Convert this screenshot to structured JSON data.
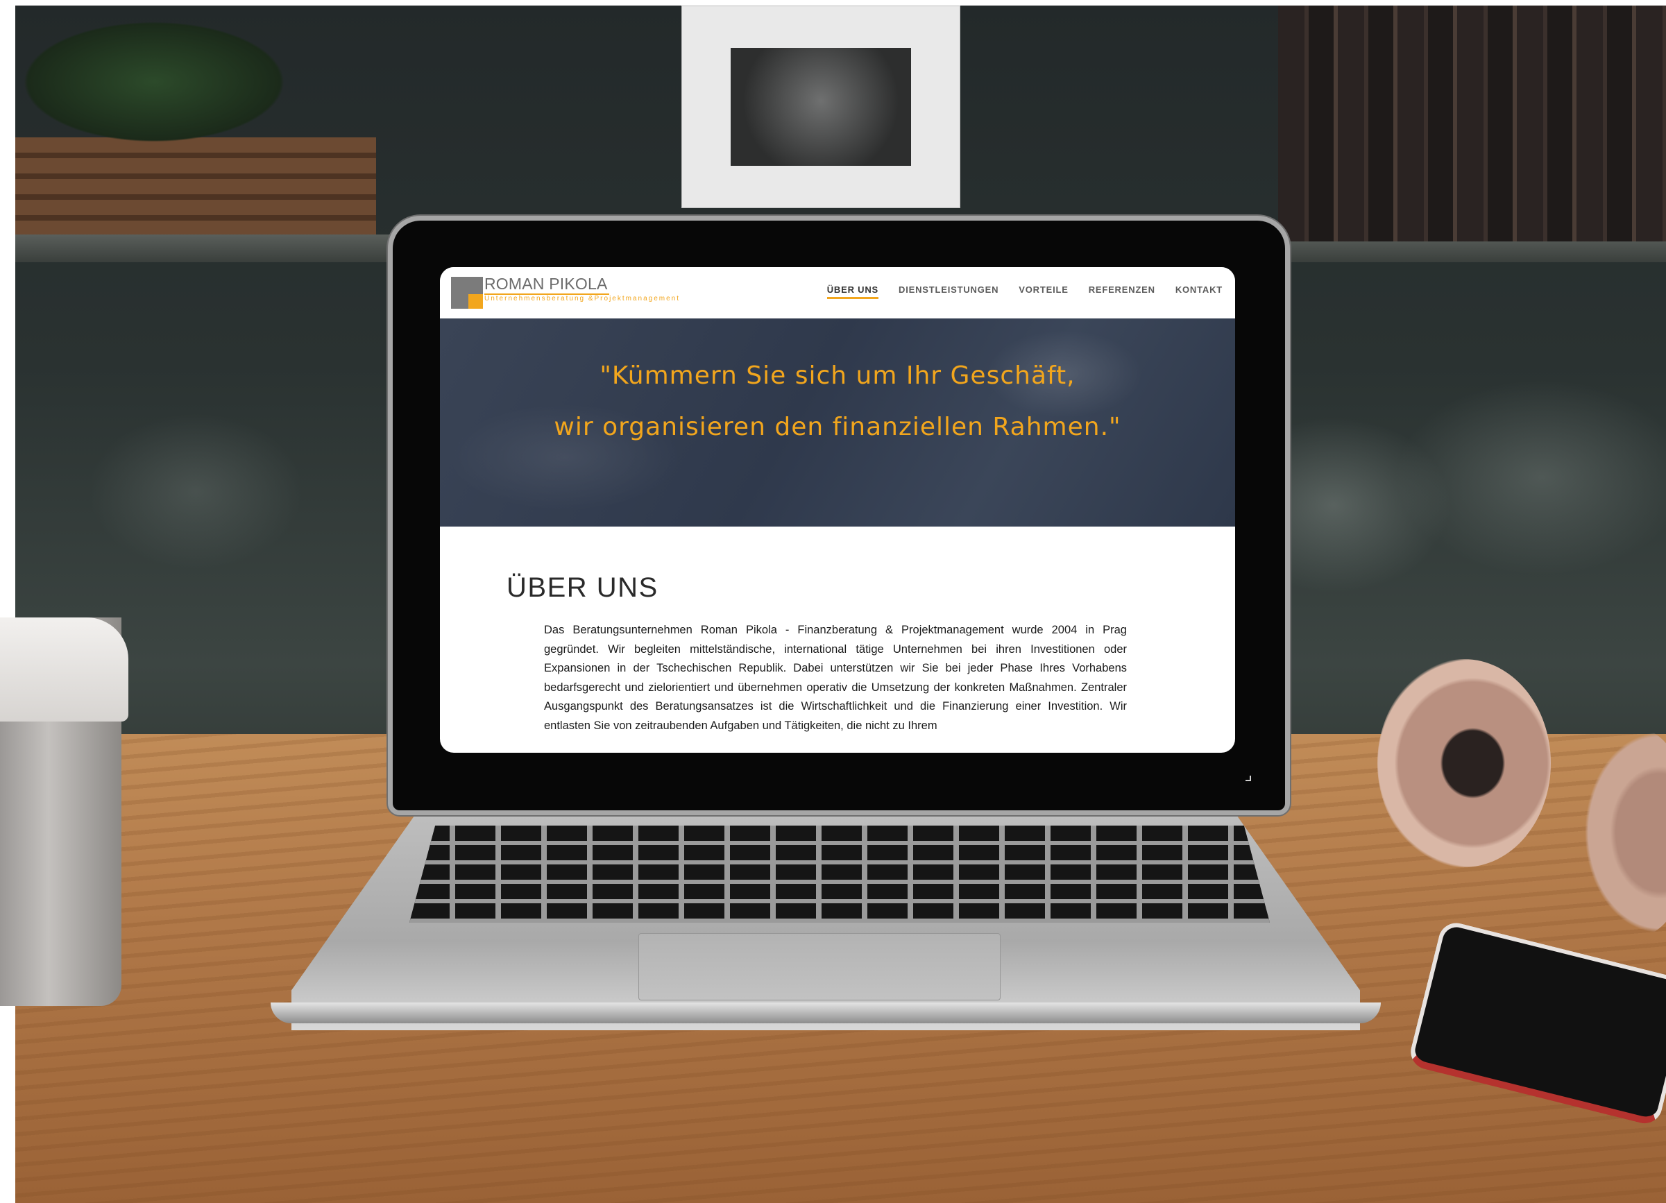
{
  "website": {
    "logo": {
      "name": "ROMAN PIKOLA",
      "subtitle": "Unternehmensberatung &Projektmanagement"
    },
    "nav": [
      "ÜBER UNS",
      "DIENSTLEISTUNGEN",
      "VORTEILE",
      "REFERENZEN",
      "KONTAKT"
    ],
    "nav_active": "ÜBER UNS",
    "hero": {
      "line1": "\"Kümmern Sie sich um Ihr Geschäft,",
      "line2": "wir organisieren den finanziellen Rahmen.\""
    },
    "section": {
      "title": "ÜBER UNS",
      "body": "Das Beratungsunternehmen Roman Pikola - Finanzberatung & Projektmanagement wurde 2004 in Prag gegründet. Wir begleiten mittelständische, international tätige Unternehmen bei ihren Investitionen oder Expansionen in der Tschechischen Republik. Dabei unterstützen wir Sie bei jeder Phase Ihres Vorhabens bedarfsgerecht und zielorientiert und übernehmen operativ die Umsetzung der konkreten Maßnahmen. Zentraler Ausgangspunkt des Beratungsansatzes ist die Wirtschaftlichkeit und die Finanzierung einer Investition. Wir entlasten Sie von zeitraubenden Aufgaben und Tätigkeiten, die nicht zu Ihrem"
    }
  },
  "colors": {
    "accent": "#f2a61d",
    "logo_gray": "#7b7b7b",
    "hero_overlay": "#2f394c"
  },
  "icons": [
    "logo-mark-icon",
    "coffee-cup",
    "headphones",
    "smartphone"
  ]
}
